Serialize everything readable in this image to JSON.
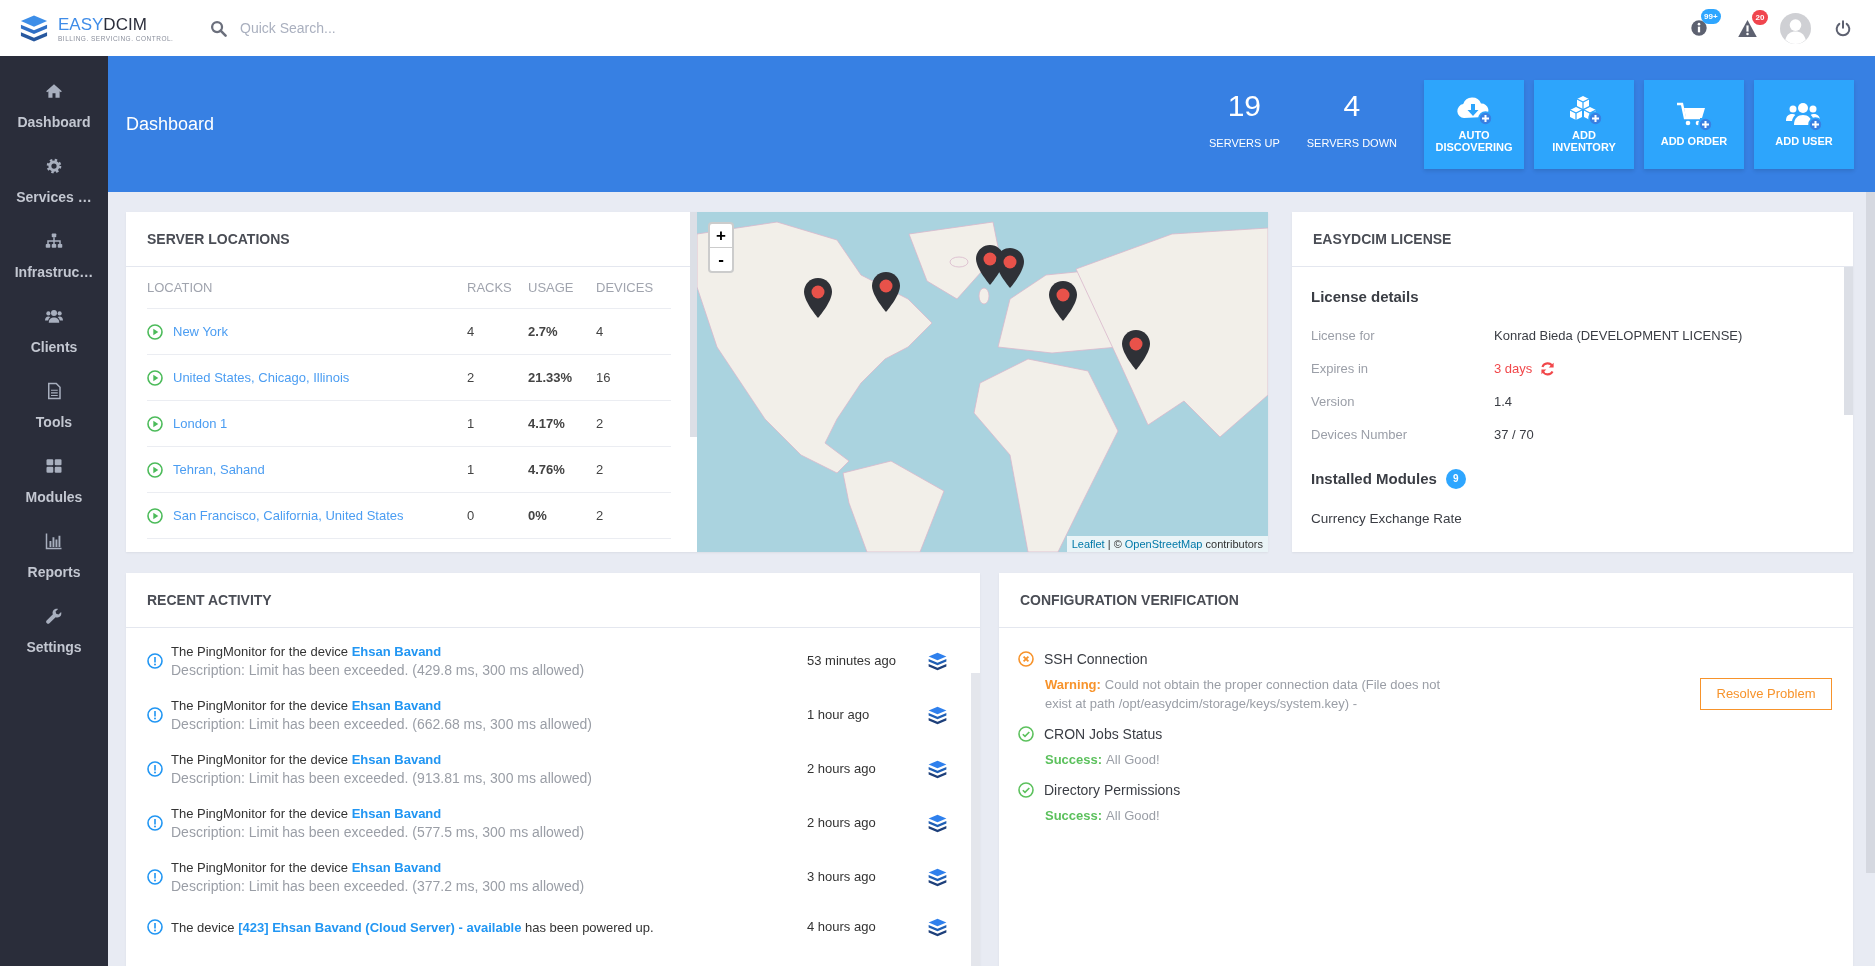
{
  "topbar": {
    "logo": {
      "name_light": "EASY",
      "name_dark": "DCIM",
      "tagline": "BILLING. SERVICING. CONTROL."
    },
    "search": {
      "placeholder": "Quick Search..."
    },
    "notifications": [
      {
        "kind": "info",
        "badge": "99+",
        "color": "#2ea6ff"
      },
      {
        "kind": "warning",
        "badge": "20",
        "color": "#f0454e"
      }
    ]
  },
  "sidebar": {
    "items": [
      {
        "kind": "dashboard",
        "label": "Dashboard"
      },
      {
        "kind": "services",
        "label": "Services …"
      },
      {
        "kind": "infrastructure",
        "label": "Infrastruc…"
      },
      {
        "kind": "clients",
        "label": "Clients"
      },
      {
        "kind": "tools",
        "label": "Tools"
      },
      {
        "kind": "modules",
        "label": "Modules"
      },
      {
        "kind": "reports",
        "label": "Reports"
      },
      {
        "kind": "settings",
        "label": "Settings"
      }
    ]
  },
  "header": {
    "title": "Dashboard",
    "stats": [
      {
        "value": "19",
        "label": "SERVERS UP"
      },
      {
        "value": "4",
        "label": "SERVERS DOWN"
      }
    ],
    "actions": [
      {
        "kind": "discover",
        "label": "AUTO DISCOVERING"
      },
      {
        "kind": "inventory",
        "label": "ADD INVENTORY"
      },
      {
        "kind": "order",
        "label": "ADD ORDER"
      },
      {
        "kind": "user",
        "label": "ADD USER"
      }
    ]
  },
  "server_locations": {
    "title": "SERVER LOCATIONS",
    "columns": [
      "LOCATION",
      "RACKS",
      "USAGE",
      "DEVICES"
    ],
    "rows": [
      {
        "location": "New York",
        "racks": "4",
        "usage": "2.7%",
        "devices": "4"
      },
      {
        "location": "United States, Chicago, Illinois",
        "racks": "2",
        "usage": "21.33%",
        "devices": "16"
      },
      {
        "location": "London 1",
        "racks": "1",
        "usage": "4.17%",
        "devices": "2"
      },
      {
        "location": "Tehran, Sahand",
        "racks": "1",
        "usage": "4.76%",
        "devices": "2"
      },
      {
        "location": "San Francisco, California, United States",
        "racks": "0",
        "usage": "0%",
        "devices": "2"
      }
    ],
    "map": {
      "zoom_in": "+",
      "zoom_out": "-",
      "attribution": {
        "leaflet": "Leaflet",
        "separator": " | © ",
        "osm": "OpenStreetMap",
        "suffix": " contributors"
      }
    }
  },
  "license": {
    "title": "EASYDCIM LICENSE",
    "details_heading": "License details",
    "rows": [
      {
        "kind": "text",
        "label": "License for",
        "value": "Konrad Bieda (DEVELOPMENT LICENSE)"
      },
      {
        "kind": "alert",
        "label": "Expires in",
        "value": "3 days"
      },
      {
        "kind": "text",
        "label": "Version",
        "value": "1.4"
      },
      {
        "kind": "text",
        "label": "Devices Number",
        "value": "37 / 70"
      }
    ],
    "modules_heading": "Installed Modules",
    "modules_count": "9",
    "modules": [
      "Currency Exchange Rate"
    ]
  },
  "recent_activity": {
    "title": "RECENT ACTIVITY",
    "items": [
      {
        "message": [
          {
            "text": "The PingMonitor for the device "
          },
          {
            "link": "Ehsan Bavand"
          }
        ],
        "description": "Description: Limit has been exceeded. (429.8 ms, 300 ms allowed)",
        "time": "53 minutes ago"
      },
      {
        "message": [
          {
            "text": "The PingMonitor for the device "
          },
          {
            "link": "Ehsan Bavand"
          }
        ],
        "description": "Description: Limit has been exceeded. (662.68 ms, 300 ms allowed)",
        "time": "1 hour ago"
      },
      {
        "message": [
          {
            "text": "The PingMonitor for the device "
          },
          {
            "link": "Ehsan Bavand"
          }
        ],
        "description": "Description: Limit has been exceeded. (913.81 ms, 300 ms allowed)",
        "time": "2 hours ago"
      },
      {
        "message": [
          {
            "text": "The PingMonitor for the device "
          },
          {
            "link": "Ehsan Bavand"
          }
        ],
        "description": "Description: Limit has been exceeded. (577.5 ms, 300 ms allowed)",
        "time": "2 hours ago"
      },
      {
        "message": [
          {
            "text": "The PingMonitor for the device "
          },
          {
            "link": "Ehsan Bavand"
          }
        ],
        "description": "Description: Limit has been exceeded. (377.2 ms, 300 ms allowed)",
        "time": "3 hours ago"
      },
      {
        "message": [
          {
            "text": "The device "
          },
          {
            "link": "[423] Ehsan Bavand (Cloud Server) - available"
          },
          {
            "text": " has been powered up."
          }
        ],
        "time": "4 hours ago"
      }
    ]
  },
  "config_verification": {
    "title": "CONFIGURATION VERIFICATION",
    "checks": [
      {
        "kind": "warning",
        "name": "SSH Connection",
        "label": "Warning:",
        "message": "Could not obtain the proper connection data (File does not exist at path /opt/easydcim/storage/keys/system.key) -",
        "action": "Resolve Problem"
      },
      {
        "kind": "success",
        "name": "CRON Jobs Status",
        "label": "Success:",
        "message": "All Good!"
      },
      {
        "kind": "success",
        "name": "Directory Permissions",
        "label": "Success:",
        "message": "All Good!"
      }
    ]
  }
}
